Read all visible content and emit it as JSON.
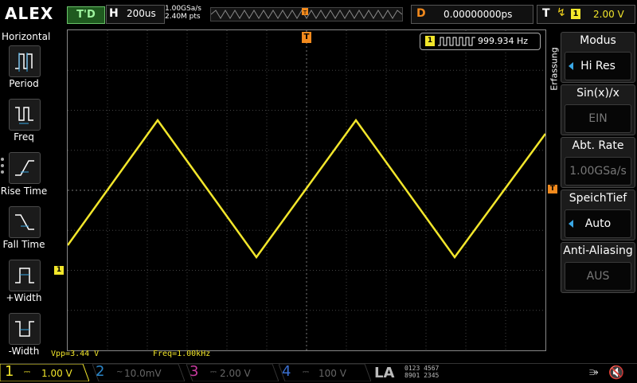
{
  "topbar": {
    "brand": "ALEX",
    "trigger_status": "T'D",
    "horizontal_label": "H",
    "timebase": "200us",
    "sample_rate": "1.00GSa/s",
    "points": "2.40M pts",
    "delay_label": "D",
    "delay_value": "0.00000000ps",
    "trigger_label": "T",
    "trigger_channel": "1",
    "trigger_level": "2.00 V"
  },
  "left_panel": {
    "title": "Horizontal",
    "buttons": [
      {
        "label": "Period",
        "icon": "period-icon"
      },
      {
        "label": "Freq",
        "icon": "freq-icon"
      },
      {
        "label": "Rise Time",
        "icon": "rise-time-icon"
      },
      {
        "label": "Fall Time",
        "icon": "fall-time-icon"
      },
      {
        "label": "+Width",
        "icon": "pos-width-icon"
      },
      {
        "label": "-Width",
        "icon": "neg-width-icon"
      }
    ]
  },
  "display": {
    "frequency_counter_channel": "1",
    "frequency_counter_value": "999.934 Hz",
    "ch1_marker": "1",
    "measure_vpp": "Vpp=3.44 V",
    "measure_freq": "Freq=1.00kHz",
    "trace_color": "#f2e62b"
  },
  "right_panel": {
    "section_label": "Erfassung",
    "items": [
      {
        "title": "Modus",
        "value": "Hi Res",
        "state": "active",
        "arrow": true
      },
      {
        "title": "Sin(x)/x",
        "value": "EIN",
        "state": "dim",
        "arrow": false
      },
      {
        "title": "Abt. Rate",
        "value": "1.00GSa/s",
        "state": "dim",
        "arrow": false
      },
      {
        "title": "SpeichTief",
        "value": "Auto",
        "state": "active",
        "arrow": true
      },
      {
        "title": "Anti-Aliasing",
        "value": "AUS",
        "state": "dim",
        "arrow": false
      }
    ]
  },
  "channels": [
    {
      "num": "1",
      "coupling": "⎓",
      "scale": "1.00 V",
      "color": "#f2e62b",
      "active": true
    },
    {
      "num": "2",
      "coupling": "~",
      "scale": "10.0mV",
      "color": "#2b86c9",
      "active": false
    },
    {
      "num": "3",
      "coupling": "⎓",
      "scale": "2.00 V",
      "color": "#c93aa0",
      "active": false
    },
    {
      "num": "4",
      "coupling": "⎓",
      "scale": "100 V",
      "color": "#3a6fd0",
      "active": false
    }
  ],
  "la": {
    "label": "LA",
    "row1": "0123 4567",
    "row2": "8901 2345"
  },
  "status": {
    "usb": "usb-icon",
    "speaker": "speaker-mute-icon"
  }
}
